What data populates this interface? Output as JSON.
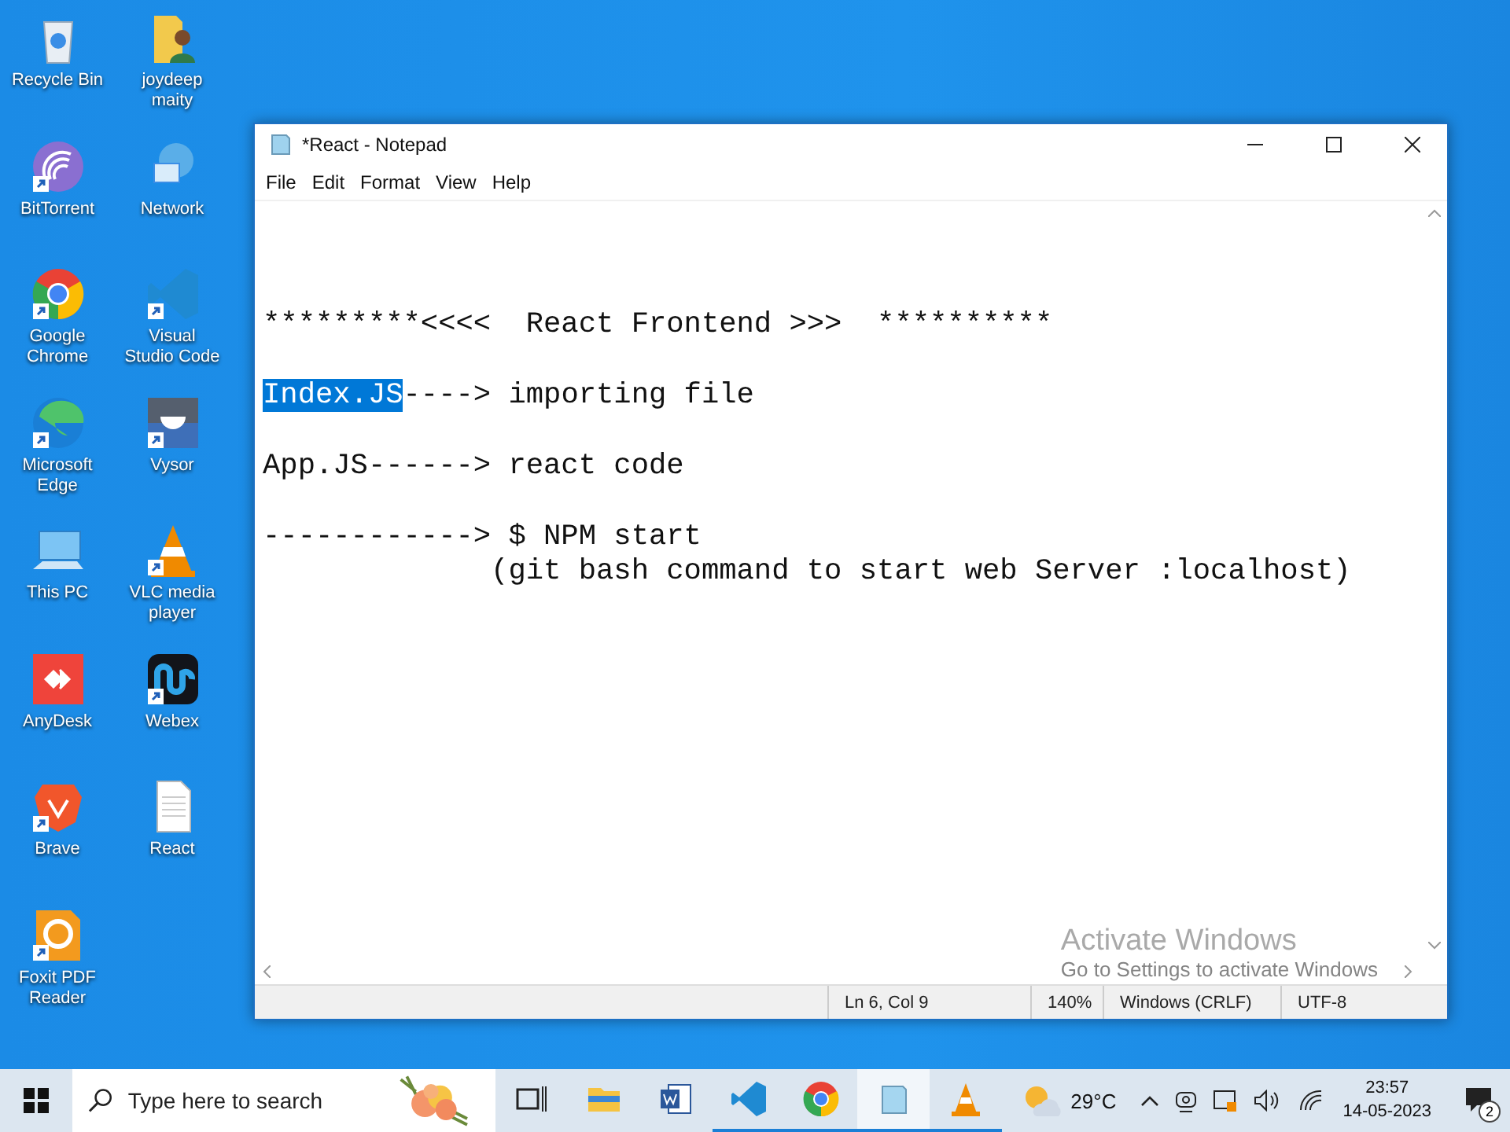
{
  "desktop_icons": [
    {
      "label": "Recycle Bin",
      "shortcut": false
    },
    {
      "label": "joydeep maity",
      "shortcut": false
    },
    {
      "label": "BitTorrent",
      "shortcut": true
    },
    {
      "label": "Network",
      "shortcut": false
    },
    {
      "label": "Google Chrome",
      "shortcut": true
    },
    {
      "label": "Visual Studio Code",
      "shortcut": true
    },
    {
      "label": "Microsoft Edge",
      "shortcut": true
    },
    {
      "label": "Vysor",
      "shortcut": true
    },
    {
      "label": "This PC",
      "shortcut": false
    },
    {
      "label": "VLC media player",
      "shortcut": true
    },
    {
      "label": "AnyDesk",
      "shortcut": false
    },
    {
      "label": "Webex",
      "shortcut": true
    },
    {
      "label": "Brave",
      "shortcut": true
    },
    {
      "label": "React",
      "shortcut": false
    },
    {
      "label": "Foxit PDF Reader",
      "shortcut": true
    }
  ],
  "window": {
    "title": "*React - Notepad"
  },
  "menu": [
    "File",
    "Edit",
    "Format",
    "View",
    "Help"
  ],
  "editor_lines": [
    {
      "blank_before": true,
      "text": "*********<<<<  React Frontend >>>  **********"
    },
    {
      "blank_before": true,
      "selected_text": "Index.JS",
      "text": "----> importing file"
    },
    {
      "blank_before": true,
      "text": "App.JS------> react code"
    },
    {
      "blank_before": true,
      "text": "------------> $ NPM start"
    },
    {
      "blank_before": false,
      "text": "             (git bash command to start web Server :localhost)"
    }
  ],
  "status_bar": {
    "position": "Ln 6, Col 9",
    "zoom": "140%",
    "line_ending": "Windows (CRLF)",
    "encoding": "UTF-8"
  },
  "activation_notice": {
    "title": "Activate Windows",
    "hint": "Go to Settings to activate Windows"
  },
  "taskbar": {
    "search": {
      "placeholder": "Type here to search"
    },
    "apps": [
      {
        "running": false,
        "selected": false
      },
      {
        "running": false,
        "selected": false
      },
      {
        "running": false,
        "selected": false
      },
      {
        "running": true,
        "selected": false
      },
      {
        "running": true,
        "selected": false
      },
      {
        "running": true,
        "selected": true
      },
      {
        "running": true,
        "selected": false
      }
    ],
    "temperature": "29°C",
    "time": "23:57",
    "date": "14-05-2023",
    "notification_count": "2"
  }
}
